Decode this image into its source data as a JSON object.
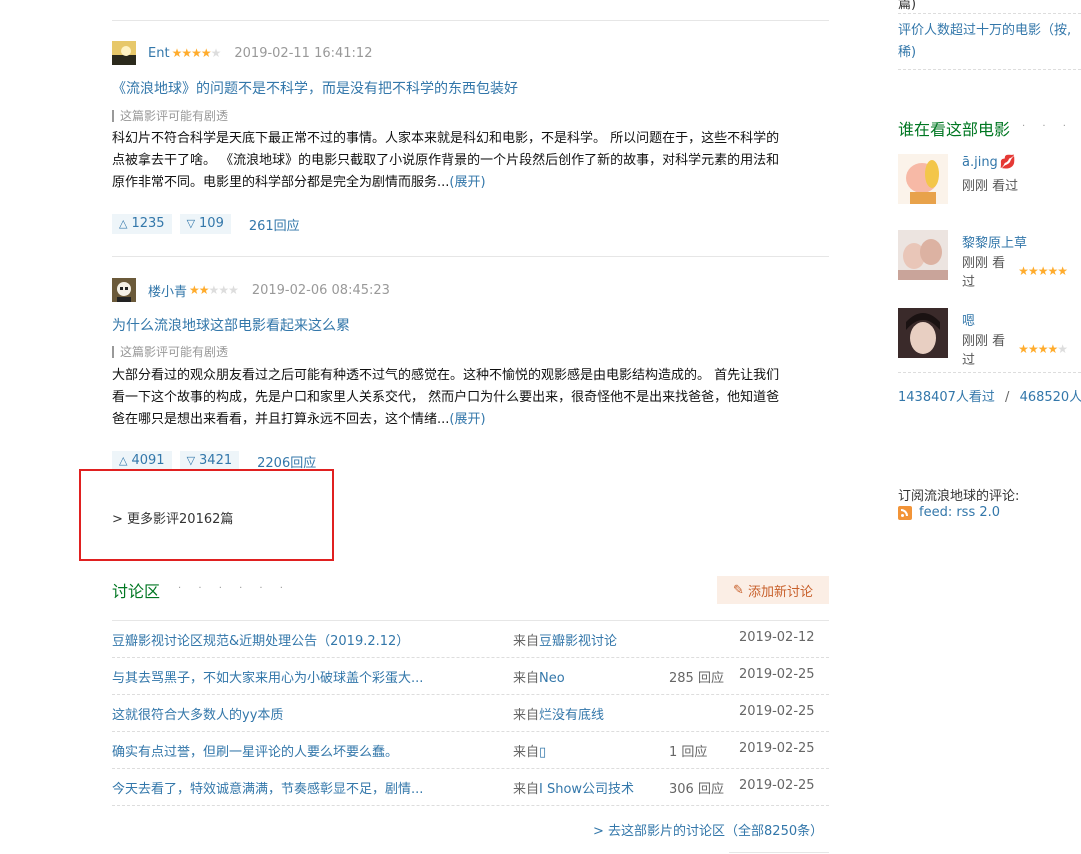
{
  "reviews": [
    {
      "user": "Ent",
      "stars": 4,
      "time": "2019-02-11 16:41:12",
      "title": "《流浪地球》的问题不是不科学，而是没有把不科学的东西包装好",
      "spoiler": "这篇影评可能有剧透",
      "lines": [
        "科幻片不符合科学是天底下最正常不过的事情。人家本来就是科幻和电影，不是科学。 所以问题在于，这些不科学的",
        "点被拿去干了啥。 《流浪地球》的电影只截取了小说原作背景的一个片段然后创作了新的故事，对科学元素的用法和",
        "原作非常不同。电影里的科学部分都是完全为剧情而服务..."
      ],
      "expand": "(展开)",
      "useful": "1235",
      "useless": "109",
      "replies": "261回应"
    },
    {
      "user": "楼小青",
      "stars": 2,
      "time": "2019-02-06 08:45:23",
      "title": "为什么流浪地球这部电影看起来这么累",
      "spoiler": "这篇影评可能有剧透",
      "lines": [
        "大部分看过的观众朋友看过之后可能有种透不过气的感觉在。这种不愉悦的观影感是由电影结构造成的。 首先让我们",
        "看一下这个故事的构成，先是户口和家里人关系交代， 然而户口为什么要出来，很奇怪他不是出来找爸爸，他知道爸",
        "爸在哪只是想出来看看，并且打算永远不回去，这个情绪..."
      ],
      "expand": "(展开)",
      "useful": "4091",
      "useless": "3421",
      "replies": "2206回应"
    }
  ],
  "more_reviews": "> 更多影评20162篇",
  "discussion": {
    "title": "讨论区",
    "dots": "· · · · · ·",
    "add_button": "添加新讨论",
    "rows": [
      {
        "title": "豆瓣影视讨论区规范&近期处理公告（2019.2.12）",
        "from": "来自豆瓣影视讨论",
        "replies": "",
        "date": "2019-02-12"
      },
      {
        "title": "与其去骂黑子，不如大家来用心为小破球盖个彩蛋大...",
        "from": "来自Neo",
        "replies": "285 回应",
        "date": "2019-02-25"
      },
      {
        "title": "这就很符合大多数人的yy本质",
        "from": "来自烂没有底线",
        "replies": "",
        "date": "2019-02-25"
      },
      {
        "title": "确实有点过誉，但刷一星评论的人要么坏要么蠢。",
        "from": "来自▯",
        "replies": "1 回应",
        "date": "2019-02-25"
      },
      {
        "title": "今天去看了，特效诚意满满，节奏感彰显不足，剧情...",
        "from": "来自I Show公司技术",
        "replies": "306 回应",
        "date": "2019-02-25"
      }
    ],
    "go_all": "> 去这部影片的讨论区（全部8250条）"
  },
  "sidebar": {
    "top_partial": "篇)",
    "top_link_1": "评价人数超过十万的电影（按,",
    "top_link_2": "稀)",
    "watching_title": "谁在看这部电影",
    "watching_dots": "· · · · · ·",
    "viewers": [
      {
        "name": "ā.jing",
        "meta": "刚刚 看过",
        "stars": 0
      },
      {
        "name": "黎黎原上草",
        "meta": "刚刚 看过",
        "stars": 5
      },
      {
        "name": "嗯",
        "meta": "刚刚 看过",
        "stars": 4
      }
    ],
    "counts_watched": "1438407人看过",
    "counts_sep": "/",
    "counts_want": "468520人想",
    "subscribe_label": "订阅流浪地球的评论:",
    "rss_label": "feed: rss 2.0"
  }
}
